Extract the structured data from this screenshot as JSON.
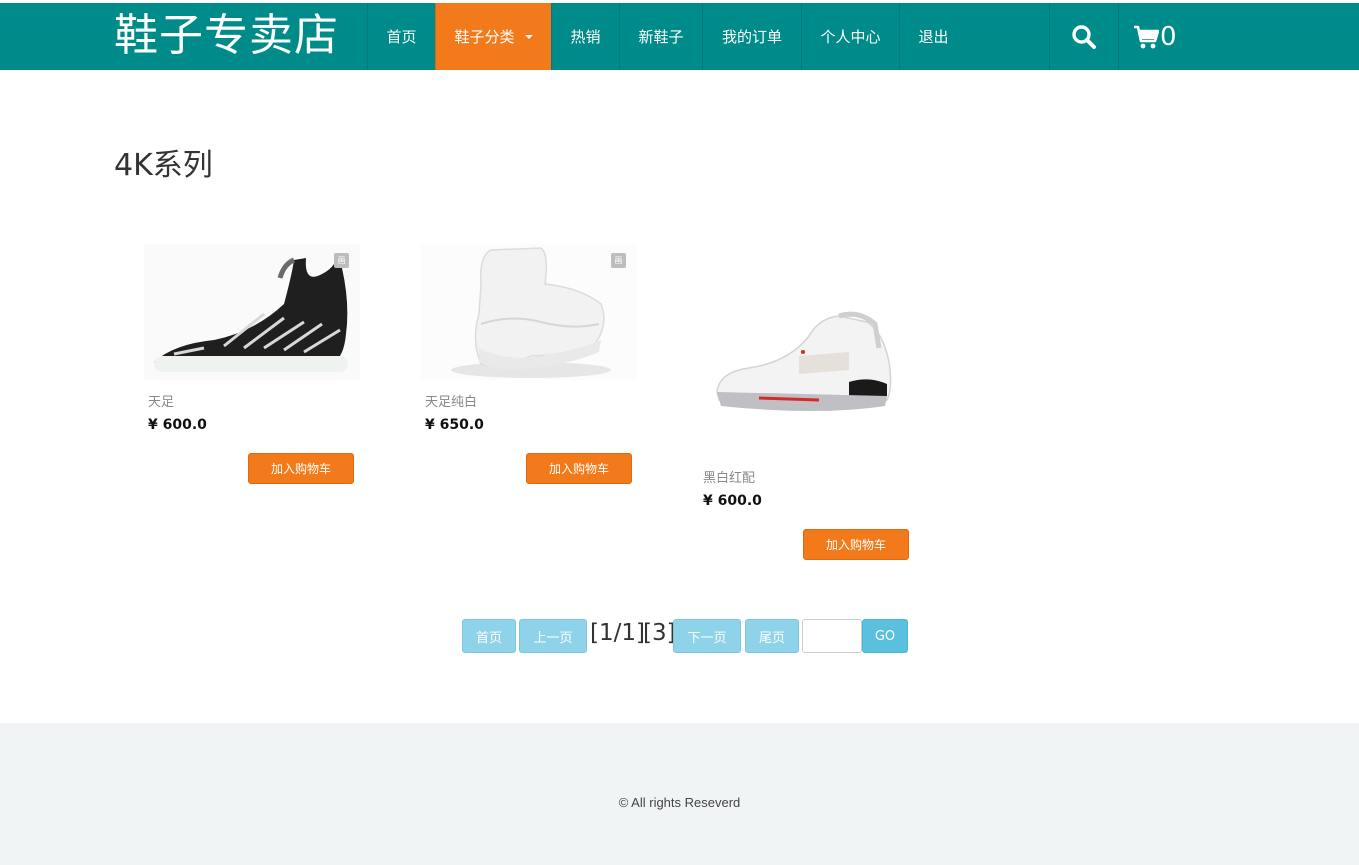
{
  "header": {
    "brand": "鞋子专卖店",
    "nav": [
      {
        "label": "首页"
      },
      {
        "label": "鞋子分类"
      },
      {
        "label": "热销"
      },
      {
        "label": "新鞋子"
      },
      {
        "label": "我的订单"
      },
      {
        "label": "个人中心"
      },
      {
        "label": "退出"
      }
    ],
    "cart_count": "0",
    "colors": {
      "bar": "#008b8b",
      "active": "#f27a1a"
    }
  },
  "category": {
    "title": "4K系列"
  },
  "products": [
    {
      "name": "天足",
      "price": "¥ 600.0",
      "button": "加入购物车",
      "image": "black-sneaker"
    },
    {
      "name": "天足纯白",
      "price": "¥ 650.0",
      "button": "加入购物车",
      "image": "white-sneaker"
    },
    {
      "name": "黑白红配",
      "price": "¥ 600.0",
      "button": "加入购物车",
      "image": "white-red-sneaker"
    }
  ],
  "pagination": {
    "first": "首页",
    "prev": "上一页",
    "current": "[1/1]",
    "total": "[3]",
    "next": "下一页",
    "last": "尾页",
    "go": "GO",
    "input_value": ""
  },
  "footer": {
    "text": "© All rights Reseverd"
  }
}
